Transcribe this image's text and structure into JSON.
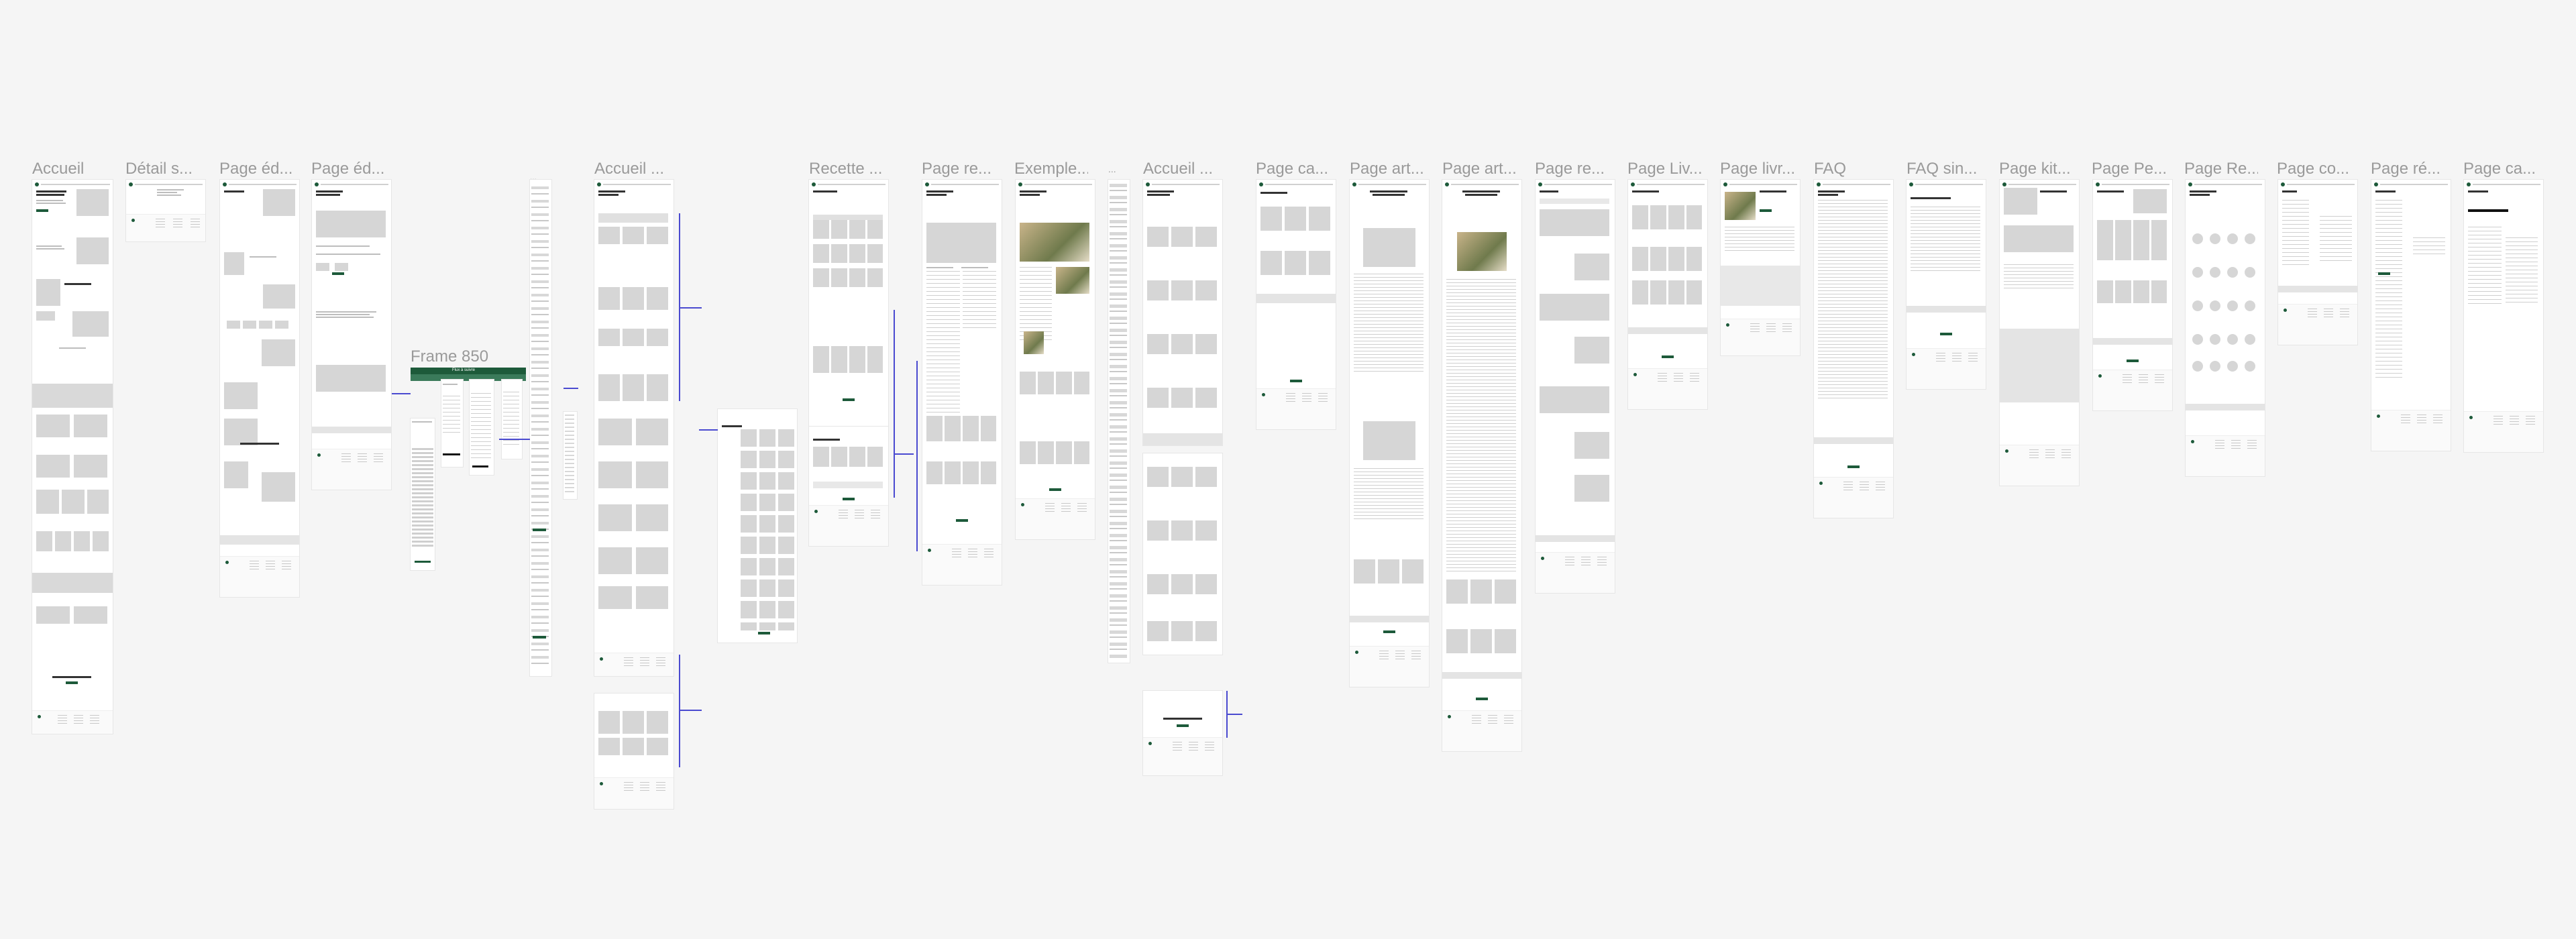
{
  "canvas": {
    "background": "#f5f5f5",
    "accent": "#1d5a3a",
    "connector": "#4a4ad0"
  },
  "frames": [
    {
      "label": "Accueil",
      "kind": "home-long"
    },
    {
      "label": "Détail s...",
      "kind": "short"
    },
    {
      "label": "Page éd...",
      "kind": "edition"
    },
    {
      "label": "Page éd...",
      "kind": "edition2"
    },
    {
      "label": "Frame 850",
      "kind": "green-header",
      "button": "Flux à suivre"
    },
    {
      "label": "...",
      "kind": "narrow"
    },
    {
      "label": "Accueil ...",
      "kind": "grid-long"
    },
    {
      "label": "...",
      "kind": "grid-mid"
    },
    {
      "label": "Recette ...",
      "kind": "recipe"
    },
    {
      "label": "Page re...",
      "kind": "recipe2"
    },
    {
      "label": "Exemple...",
      "kind": "example"
    },
    {
      "label": "...",
      "kind": "narrow2"
    },
    {
      "label": "Accueil ...",
      "kind": "home2"
    },
    {
      "label": "Page ca...",
      "kind": "cat"
    },
    {
      "label": "Page art...",
      "kind": "article"
    },
    {
      "label": "Page art...",
      "kind": "article2"
    },
    {
      "label": "Page re...",
      "kind": "search"
    },
    {
      "label": "Page Liv...",
      "kind": "books"
    },
    {
      "label": "Page livr...",
      "kind": "book"
    },
    {
      "label": "FAQ",
      "kind": "faq"
    },
    {
      "label": "FAQ sin...",
      "kind": "faq2"
    },
    {
      "label": "Page kit...",
      "kind": "kit"
    },
    {
      "label": "Page Pe...",
      "kind": "pe"
    },
    {
      "label": "Page Re...",
      "kind": "people"
    },
    {
      "label": "Page co...",
      "kind": "contact"
    },
    {
      "label": "Page ré...",
      "kind": "res"
    },
    {
      "label": "Page ca...",
      "kind": "cart"
    }
  ]
}
